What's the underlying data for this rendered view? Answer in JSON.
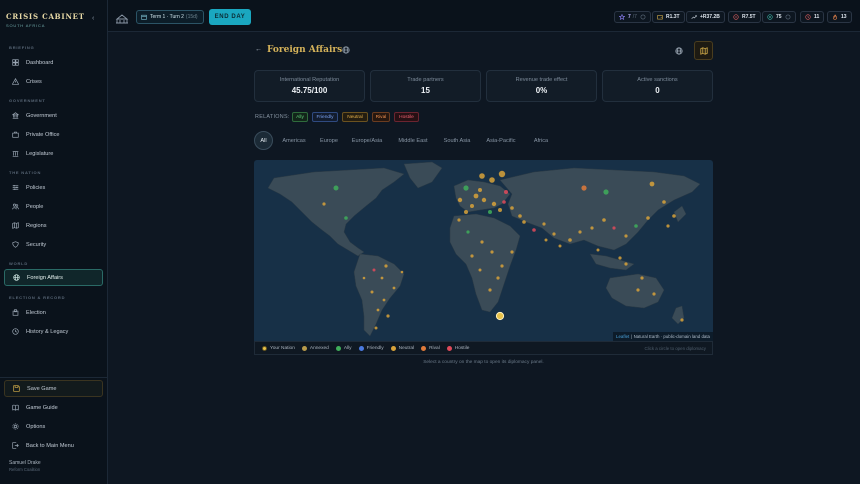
{
  "app": {
    "title": "CRISIS CABINET",
    "subtitle": "SOUTH AFRICA"
  },
  "sidebar": {
    "sections": {
      "briefing": "BRIEFING",
      "government": "GOVERNMENT",
      "the_nation": "THE NATION",
      "world": "WORLD",
      "election": "ELECTION & RECORD"
    },
    "items": [
      {
        "label": "Dashboard",
        "icon": "grid-icon"
      },
      {
        "label": "Crises",
        "icon": "alert-icon"
      },
      {
        "label": "Government",
        "icon": "building-icon"
      },
      {
        "label": "Private Office",
        "icon": "briefcase-icon"
      },
      {
        "label": "Legislature",
        "icon": "columns-icon"
      },
      {
        "label": "Policies",
        "icon": "sliders-icon"
      },
      {
        "label": "People",
        "icon": "people-icon"
      },
      {
        "label": "Regions",
        "icon": "map-icon"
      },
      {
        "label": "Security",
        "icon": "shield-icon"
      },
      {
        "label": "Foreign Affairs",
        "icon": "globe-icon"
      },
      {
        "label": "Election",
        "icon": "ballot-icon"
      },
      {
        "label": "History & Legacy",
        "icon": "clock-icon"
      }
    ],
    "bottom": [
      {
        "label": "Save Game",
        "icon": "save-icon"
      },
      {
        "label": "Game Guide",
        "icon": "book-icon"
      },
      {
        "label": "Options",
        "icon": "gear-icon"
      },
      {
        "label": "Back to Main Menu",
        "icon": "exit-icon"
      }
    ],
    "user": {
      "name": "Samuel Drake",
      "role": "Reform Coalition"
    }
  },
  "topbar": {
    "term": "Term 1 · Turn 2",
    "term_sub": "(15d)",
    "end_day": "END DAY",
    "stats": [
      {
        "value": "7",
        "dim": "/7",
        "icon": "star-icon",
        "color": "#8a7df0"
      },
      {
        "value": "R1.3T",
        "icon": "wallet-icon",
        "color": "#d8b04a"
      },
      {
        "value": "+R37.2B",
        "icon": "trend-icon",
        "color": "#c9d2dc"
      },
      {
        "value": "R7.5T",
        "icon": "debt-icon",
        "color": "#e06060"
      },
      {
        "value": "75",
        "icon": "approval-icon",
        "color": "#3fb8a8"
      },
      {
        "value": "11",
        "icon": "clock-icon",
        "color": "#e06060"
      },
      {
        "value": "13",
        "icon": "fire-icon",
        "color": "#e0804a"
      }
    ]
  },
  "page": {
    "title": "Foreign Affairs",
    "back": "←",
    "cards": [
      {
        "label": "International Reputation",
        "value": "45.75/100"
      },
      {
        "label": "Trade partners",
        "value": "15"
      },
      {
        "label": "Revenue trade effect",
        "value": "0%"
      },
      {
        "label": "Active sanctions",
        "value": "0"
      }
    ],
    "relations_label": "RELATIONS:",
    "relations": [
      {
        "label": "Ally",
        "color": "#3fae5a"
      },
      {
        "label": "Friendly",
        "color": "#4a7ae0"
      },
      {
        "label": "Neutral",
        "color": "#d8a23a"
      },
      {
        "label": "Rival",
        "color": "#e07a3a"
      },
      {
        "label": "Hostile",
        "color": "#e04a5a"
      }
    ],
    "tabs": [
      "All",
      "Americas",
      "Europe",
      "Europe/Asia",
      "Middle East",
      "South Asia",
      "Asia-Pacific",
      "Africa"
    ],
    "map_attribution": {
      "leaflet": "Leaflet",
      "rest": "| Natural Earth · public-domain land data"
    },
    "legend": [
      {
        "label": "Your Nation",
        "color": "#e8c24a"
      },
      {
        "label": "Annexed",
        "color": "#b89a4a"
      },
      {
        "label": "Ally",
        "color": "#3fae5a"
      },
      {
        "label": "Friendly",
        "color": "#4a7ae0"
      },
      {
        "label": "Neutral",
        "color": "#d8a23a"
      },
      {
        "label": "Rival",
        "color": "#e07a3a"
      },
      {
        "label": "Hostile",
        "color": "#e04a5a"
      }
    ],
    "legend_hint": "Click a circle to open diplomacy",
    "footnote": "Select a country on the map to open its diplomacy panel."
  }
}
